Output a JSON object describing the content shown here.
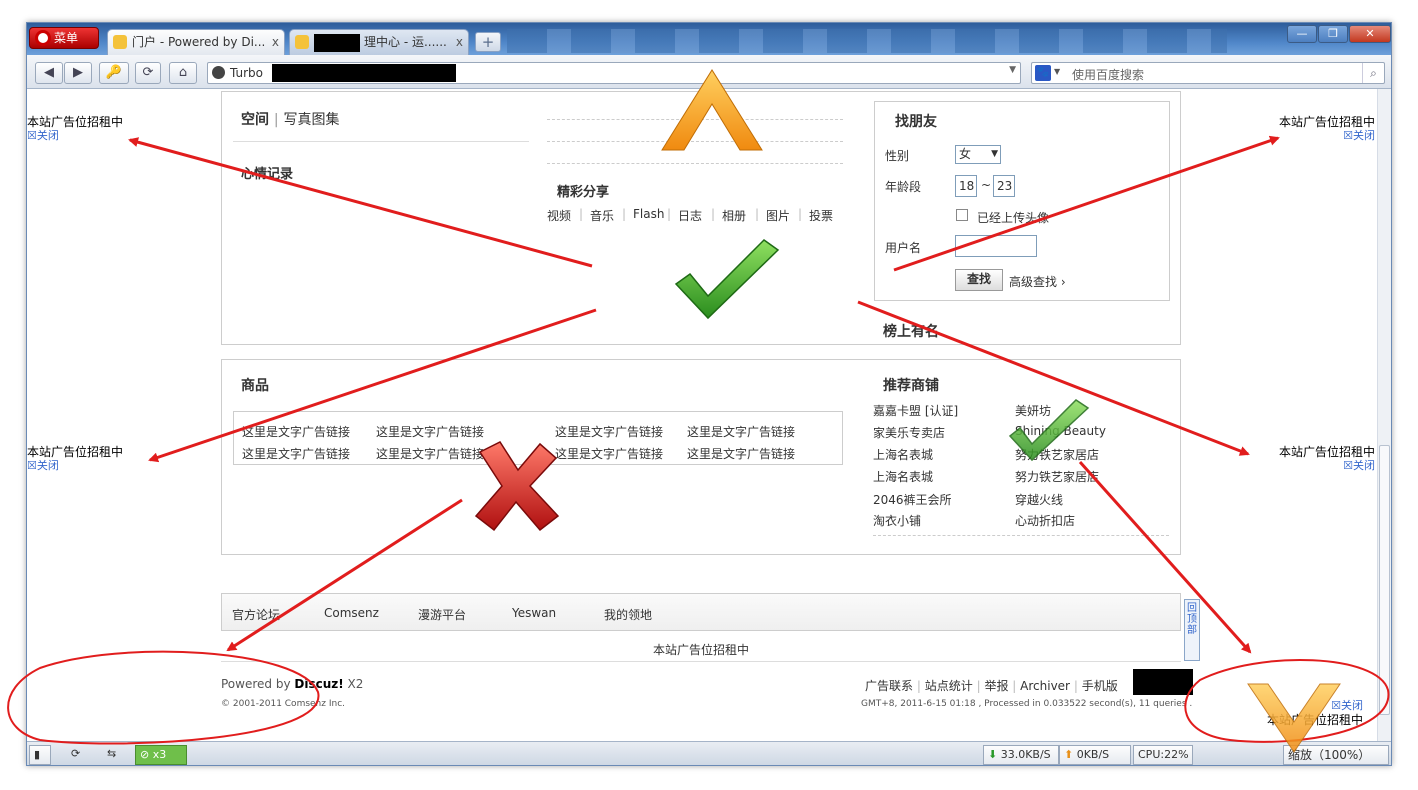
{
  "browser": {
    "menu_label": "菜单",
    "tabs": [
      {
        "title": "门户 - Powered by Di...",
        "close": "x"
      },
      {
        "title": "理中心 - 运......",
        "close": "x"
      }
    ],
    "newtab": "+",
    "window_controls": {
      "minimize": "—",
      "restore": "❐",
      "close": "✕"
    },
    "nav": {
      "back": "◀",
      "forward": "▶",
      "key": "🔑",
      "reload": "⟳",
      "home": "⌂"
    },
    "address": {
      "turbo_label": "Turbo",
      "dropdown": "▼"
    },
    "search": {
      "placeholder": "使用百度搜索",
      "engine_icon": "paw-icon",
      "engine_glyph": "🐾"
    }
  },
  "ads": {
    "text": "本站广告位招租中",
    "close": "☒关闭"
  },
  "space": {
    "title_main": "空间",
    "title_sep": "|",
    "title_sub": "写真图集",
    "mood": "心情记录"
  },
  "share": {
    "title": "精彩分享",
    "items": [
      "视频",
      "音乐",
      "Flash",
      "日志",
      "相册",
      "图片",
      "投票"
    ],
    "separator": "|"
  },
  "friends": {
    "title": "找朋友",
    "gender_label": "性别",
    "gender_value": "女",
    "age_label": "年龄段",
    "age_min": "18",
    "age_tilde": "~",
    "age_max": "23",
    "avatar_check": "已经上传头像",
    "username_label": "用户名",
    "search_button": "查找",
    "advanced": "高级查找 ›",
    "ranking": "榜上有名"
  },
  "goods": {
    "title": "商品",
    "rows": [
      [
        "这里是文字广告链接",
        "这里是文字广告链接",
        "这里是文字广告链接",
        "这里是文字广告链接"
      ],
      [
        "这里是文字广告链接",
        "这里是文字广告链接",
        "这里是文字广告链接",
        "这里是文字广告链接"
      ]
    ]
  },
  "shops": {
    "title": "推荐商铺",
    "left": [
      "嘉嘉卡盟 [认证]",
      "家美乐专卖店",
      "上海名表城",
      "上海名表城",
      "2046裤王会所",
      "淘衣小铺"
    ],
    "right": [
      "美妍坊",
      "Shining Beauty",
      "努力铁艺家居店",
      "努力铁艺家居店",
      "穿越火线",
      "心动折扣店"
    ]
  },
  "navlinks": [
    "官方论坛",
    "Comsenz",
    "漫游平台",
    "Yeswan",
    "我的领地"
  ],
  "footer": {
    "center_ad": "本站广告位招租中",
    "powered_prefix": "Powered by ",
    "powered_brand": "Discuz!",
    "powered_version": " X2",
    "copyright": "© 2001-2011 Comsenz Inc.",
    "links": [
      "广告联系",
      "站点统计",
      "举报",
      "Archiver",
      "手机版"
    ],
    "link_sep": "|",
    "timing": "GMT+8, 2011-6-15 01:18 , Processed in 0.033522 second(s), 11 queries ."
  },
  "backtop": "回顶部",
  "statusbar": {
    "badge": "x3",
    "download": "33.0KB/S",
    "upload": "0KB/S",
    "cpu": "CPU:22%",
    "zoom": "缩放（100%）"
  },
  "colors": {
    "annotation": "#e11d1d",
    "check": "#3aa52a",
    "cross": "#c61f1f",
    "chevron": "#f6a21c",
    "link_blue": "#3366cc"
  }
}
